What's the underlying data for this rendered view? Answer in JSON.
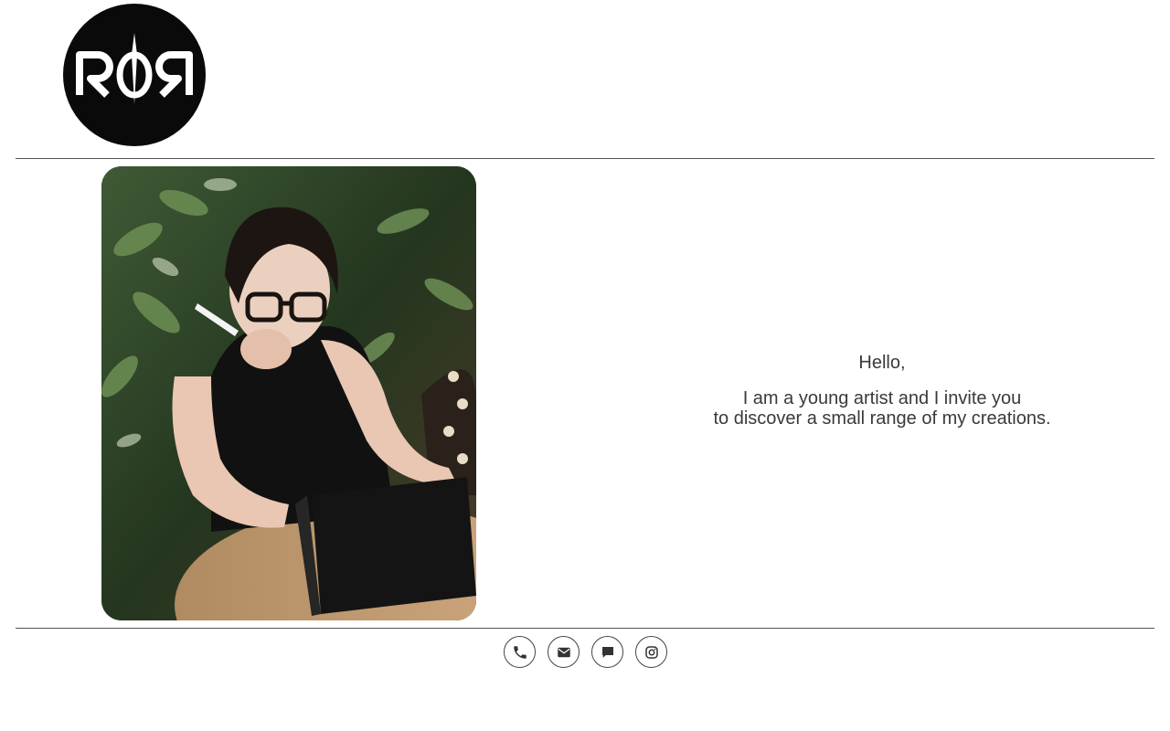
{
  "logo": {
    "text": "RØR"
  },
  "intro": {
    "greeting": "Hello,",
    "line1": "I am a young artist and I invite you",
    "line2": "to discover a small range of my creations."
  },
  "contacts": [
    {
      "icon": "phone-icon"
    },
    {
      "icon": "envelope-icon"
    },
    {
      "icon": "chat-bubble-icon"
    },
    {
      "icon": "instagram-icon"
    }
  ],
  "colors": {
    "background": "#ffffff",
    "text": "#3a3a3a",
    "logo_bg": "#0a0a0a",
    "divider": "#555555"
  }
}
